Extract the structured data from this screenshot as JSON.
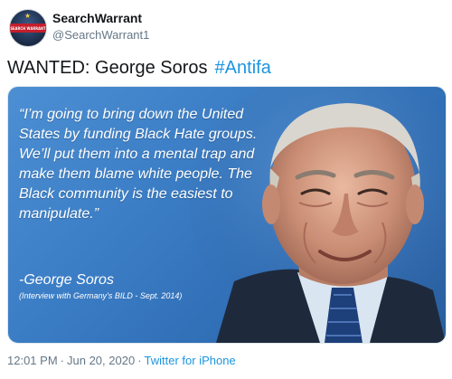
{
  "user": {
    "display_name": "SearchWarrant",
    "handle": "@SearchWarrant1",
    "avatar_text": "SEARCH WARRANT"
  },
  "tweet": {
    "text": "WANTED:  George Soros",
    "hashtag": "#Antifa"
  },
  "media": {
    "quote": "“I’m going to bring down the United States by funding Black Hate groups. We’ll put them into a mental trap and make them blame white people. The Black community is the easiest to manipulate.”",
    "attribution_name": "-George Soros",
    "attribution_source": "(Interview with Germany’s BILD  - Sept. 2014)"
  },
  "meta": {
    "time": "12:01 PM",
    "date": "Jun 20, 2020",
    "separator": "·",
    "source": "Twitter for iPhone"
  },
  "colors": {
    "text": "#14171a",
    "secondary": "#657786",
    "link": "#1b95e0",
    "image_blue": "#3a7cc4"
  }
}
